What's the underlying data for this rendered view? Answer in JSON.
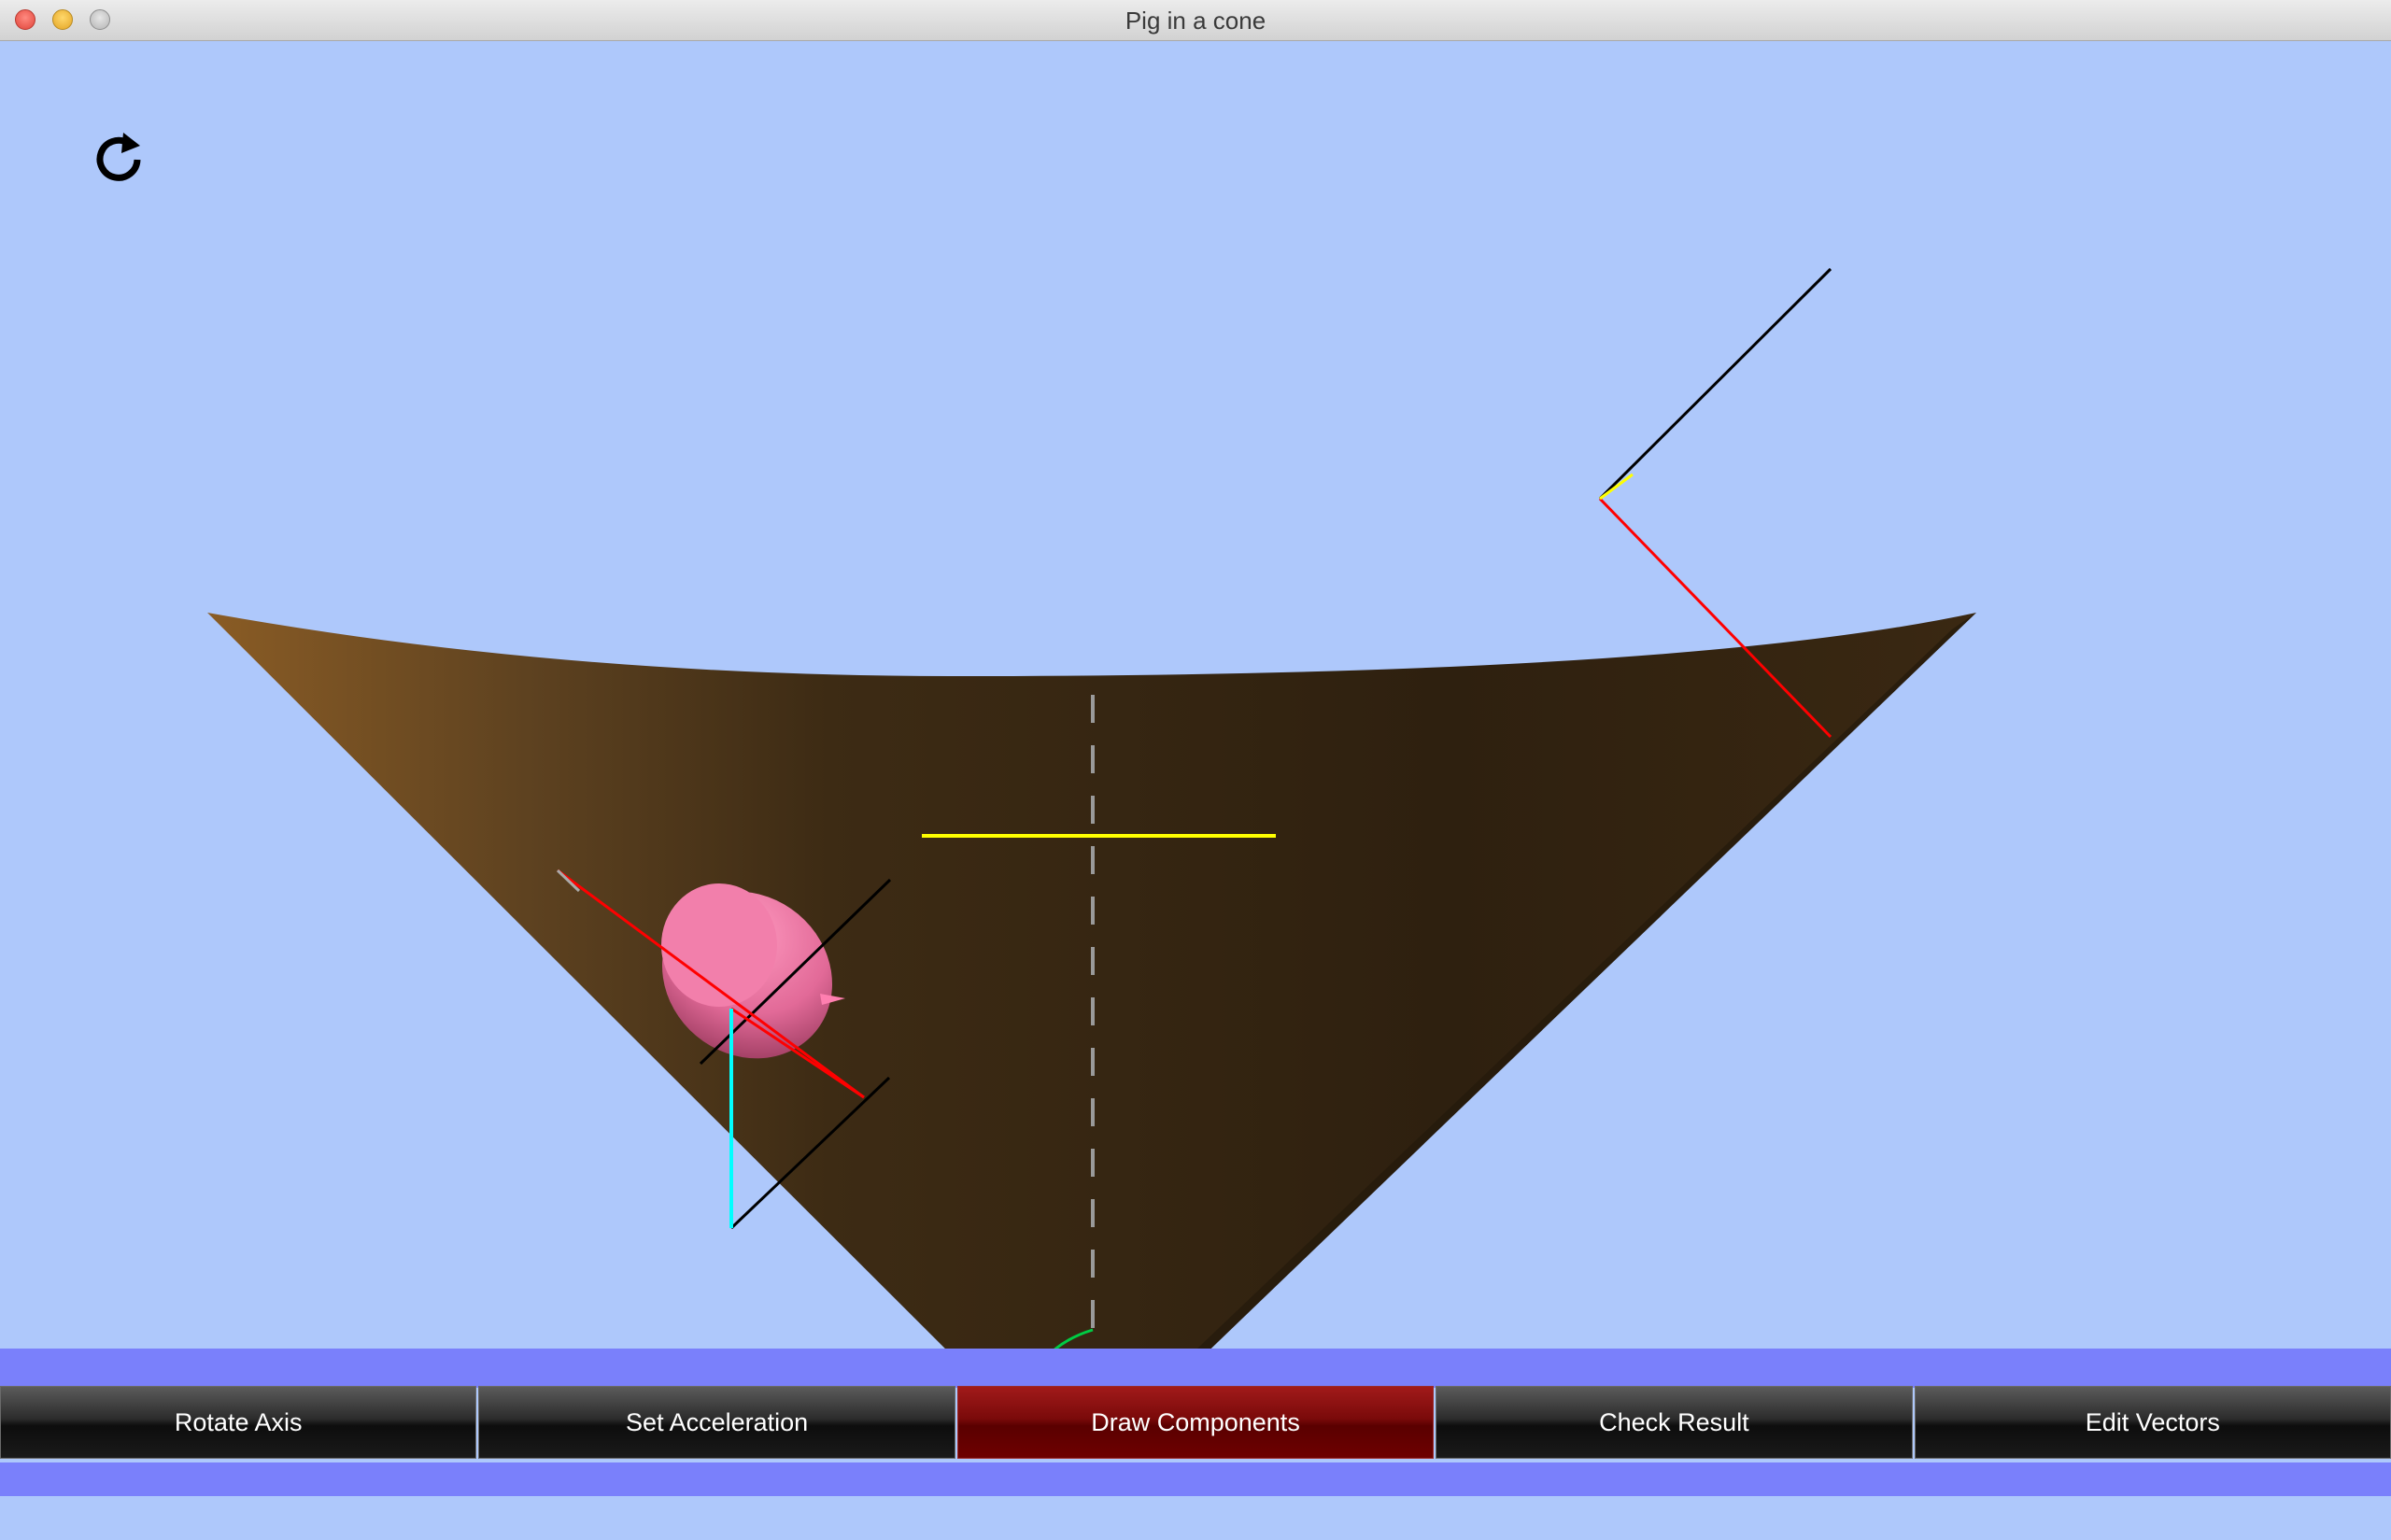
{
  "window": {
    "title": "Pig in a cone"
  },
  "icons": {
    "reset": "rotate-reset-icon"
  },
  "toolbar": {
    "buttons": [
      {
        "label": "Rotate Axis",
        "active": false
      },
      {
        "label": "Set Acceleration",
        "active": false
      },
      {
        "label": "Draw Components",
        "active": true
      },
      {
        "label": "Check Result",
        "active": false
      },
      {
        "label": "Edit Vectors",
        "active": false
      }
    ]
  },
  "colors": {
    "sky": "#aec8fb",
    "cone": "#3a2a15",
    "pig": "#e86a9a",
    "accent_active": "#6e0000",
    "vector_red": "#ff0000",
    "vector_black": "#000000",
    "vector_cyan": "#00ffff",
    "vector_yellow": "#ffff00",
    "angle_arc": "#00ff00"
  }
}
